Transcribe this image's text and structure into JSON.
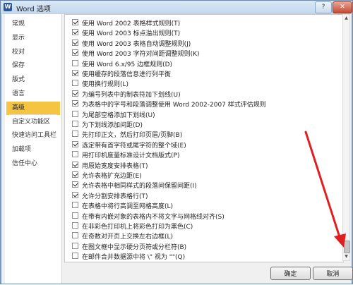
{
  "window": {
    "title": "Word 选项",
    "help_glyph": "?",
    "close_glyph": "✕",
    "icon_letter": "W"
  },
  "sidebar": {
    "items": [
      {
        "label": "常规",
        "active": false
      },
      {
        "label": "显示",
        "active": false
      },
      {
        "label": "校对",
        "active": false
      },
      {
        "label": "保存",
        "active": false
      },
      {
        "label": "版式",
        "active": false
      },
      {
        "label": "语言",
        "active": false
      },
      {
        "label": "高级",
        "active": true
      },
      {
        "label": "自定义功能区",
        "active": false
      },
      {
        "label": "快速访问工具栏",
        "active": false
      },
      {
        "label": "加载项",
        "active": false
      },
      {
        "label": "信任中心",
        "active": false
      }
    ]
  },
  "options": [
    {
      "label": "使用 Word 2002 表格样式规则(T)",
      "checked": true
    },
    {
      "label": "使用 Word 2003 标点溢出规则(T)",
      "checked": true
    },
    {
      "label": "使用 Word 2003 表格自动调整规则(J)",
      "checked": true
    },
    {
      "label": "使用 Word 2003 字符对间距调整规则(K)",
      "checked": true
    },
    {
      "label": "使用 Word 6.x/95 边框规则(D)",
      "checked": false
    },
    {
      "label": "使用缓存的段落信息进行列平衡",
      "checked": true
    },
    {
      "label": "使用换行规则(L)",
      "checked": false
    },
    {
      "label": "为编号列表中的制表符加下划线(U)",
      "checked": true
    },
    {
      "label": "为表格中的字号和段落调整使用 Word 2002-2007 样式评估规则",
      "checked": true
    },
    {
      "label": "为尾部空格添加下划线(U)",
      "checked": false
    },
    {
      "label": "为下划线添加间距(D)",
      "checked": false
    },
    {
      "label": "先打印正文，然后打印页眉/页脚(B)",
      "checked": false
    },
    {
      "label": "选定带有首字符或尾字符的整个域(E)",
      "checked": true
    },
    {
      "label": "用打印机度量标准设计文档版式(P)",
      "checked": false
    },
    {
      "label": "用原始宽度安排表格(T)",
      "checked": true
    },
    {
      "label": "允许表格扩充边距(E)",
      "checked": true
    },
    {
      "label": "允许表格中相同样式的段落间保留间距(I)",
      "checked": true
    },
    {
      "label": "允许分割安排表格行(T)",
      "checked": true
    },
    {
      "label": "在表格中将行高调至网格高度(L)",
      "checked": false
    },
    {
      "label": "在带有内嵌对象的表格内不将文字与网格线对齐(S)",
      "checked": false
    },
    {
      "label": "在非彩色打印机上将彩色打印为黑色(C)",
      "checked": false
    },
    {
      "label": "在奇数对开页上交换左右边框(L)",
      "checked": false
    },
    {
      "label": "在图文框中显示硬分页符或分栏符(B)",
      "checked": false
    },
    {
      "label": "在邮件合并数据源中将 \\\" 视为 \"\"(Q)",
      "checked": false
    }
  ],
  "scrollbar": {
    "up_glyph": "▲",
    "down_glyph": "▼",
    "position": 0.95
  },
  "buttons": {
    "ok": "确定",
    "cancel": "取消"
  },
  "colors": {
    "accent_active": "#f5c542",
    "annotation_arrow": "#e02020"
  }
}
